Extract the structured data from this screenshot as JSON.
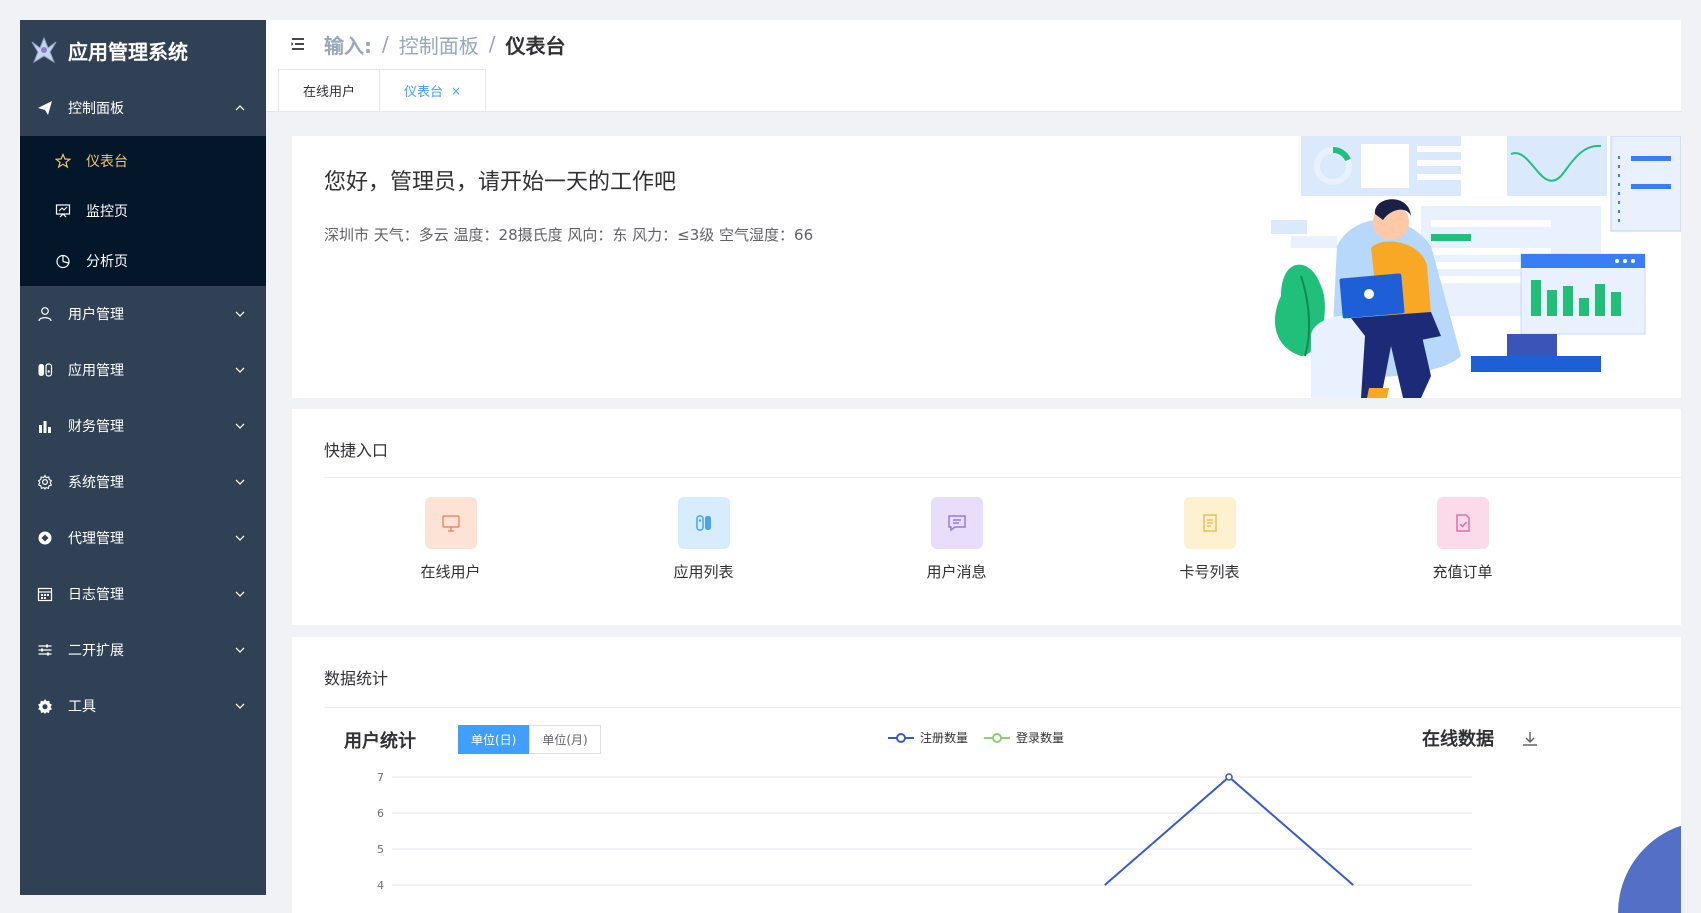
{
  "sidebar": {
    "brand": "应用管理系统",
    "dashboard_group": {
      "label": "控制面板",
      "items": [
        {
          "label": "仪表台",
          "icon": "star-icon"
        },
        {
          "label": "监控页",
          "icon": "monitor-icon"
        },
        {
          "label": "分析页",
          "icon": "pie-icon"
        }
      ]
    },
    "menus": [
      {
        "label": "用户管理",
        "icon": "user-icon"
      },
      {
        "label": "应用管理",
        "icon": "switch-icon"
      },
      {
        "label": "财务管理",
        "icon": "bar-chart-icon"
      },
      {
        "label": "系统管理",
        "icon": "gear-icon"
      },
      {
        "label": "代理管理",
        "icon": "agent-icon"
      },
      {
        "label": "日志管理",
        "icon": "calendar-icon"
      },
      {
        "label": "二开扩展",
        "icon": "sliders-icon"
      },
      {
        "label": "工具",
        "icon": "cog-icon"
      }
    ]
  },
  "header": {
    "breadcrumb": [
      "输入:",
      "控制面板",
      "仪表台"
    ]
  },
  "tabs": [
    {
      "label": "在线用户"
    },
    {
      "label": "仪表台",
      "close": "×"
    }
  ],
  "welcome": {
    "greeting": "您好，管理员，请开始一天的工作吧",
    "weather": "深圳市 天气：多云 温度：28摄氏度 风向：东 风力：≤3级 空气湿度：66"
  },
  "quick": {
    "title": "快捷入口",
    "items": [
      {
        "label": "在线用户",
        "icon": "monitor-icon",
        "bg": "#fde2d6",
        "fg": "#f08c63"
      },
      {
        "label": "应用列表",
        "icon": "switch-icon",
        "bg": "#d7ecfd",
        "fg": "#4aa3f0"
      },
      {
        "label": "用户消息",
        "icon": "message-icon",
        "bg": "#e8ddfb",
        "fg": "#9a7ae0"
      },
      {
        "label": "卡号列表",
        "icon": "document-icon",
        "bg": "#fdf1cf",
        "fg": "#e8c35a"
      },
      {
        "label": "充值订单",
        "icon": "order-icon",
        "bg": "#fbdbea",
        "fg": "#e36fa8"
      }
    ]
  },
  "stats": {
    "title": "数据统计",
    "user_stats": "用户统计",
    "unit_day": "单位(日)",
    "unit_month": "单位(月)",
    "legend": [
      "注册数量",
      "登录数量"
    ],
    "online_title": "在线数据"
  },
  "colors": {
    "series_register": "#3a5bbf",
    "series_login": "#91cc75",
    "pie": "#5470c6"
  },
  "chart_data": {
    "type": "line",
    "y_ticks": [
      7,
      6,
      5,
      4
    ],
    "ylim": [
      4,
      7
    ],
    "series": [
      {
        "name": "注册数量",
        "points": [
          [
            0.66,
            4
          ],
          [
            0.775,
            7
          ],
          [
            0.89,
            4
          ]
        ]
      }
    ]
  }
}
